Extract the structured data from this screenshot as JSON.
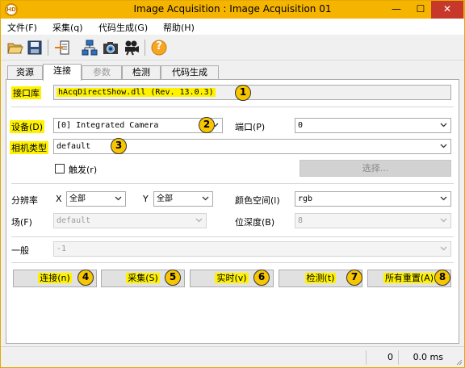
{
  "window": {
    "title": "Image Acquisition : Image Acquisition 01",
    "controls": {
      "minimize": "—",
      "maximize": "☐",
      "close": "✕"
    }
  },
  "menu": [
    "文件(F)",
    "采集(q)",
    "代码生成(G)",
    "帮助(H)"
  ],
  "toolbar": {
    "icons": [
      "open-folder-icon",
      "save-icon",
      "export-icon",
      "network-icon",
      "camera-icon",
      "video-camera-icon",
      "help-icon"
    ],
    "help_glyph": "?"
  },
  "tabs": [
    {
      "label": "资源",
      "state": "normal"
    },
    {
      "label": "连接",
      "state": "active"
    },
    {
      "label": "参数",
      "state": "disabled"
    },
    {
      "label": "检测",
      "state": "normal"
    },
    {
      "label": "代码生成",
      "state": "normal"
    }
  ],
  "connection": {
    "interface_label": "接口库",
    "interface_value": "hAcqDirectShow.dll (Rev. 13.0.3)",
    "device_label": "设备(D)",
    "device_value": "[0] Integrated Camera",
    "port_label": "端口(P)",
    "port_value": "0",
    "camera_type_label": "相机类型",
    "camera_type_value": "default",
    "trigger_label": "触发(r)",
    "trigger_checked": false,
    "select_button": "选择...",
    "resolution_label": "分辨率",
    "res_x_label": "X",
    "res_x_value": "全部",
    "res_y_label": "Y",
    "res_y_value": "全部",
    "color_space_label": "颜色空间(l)",
    "color_space_value": "rgb",
    "field_label": "场(F)",
    "field_value": "default",
    "bit_depth_label": "位深度(B)",
    "bit_depth_value": "8",
    "general_label": "一般",
    "general_value": "-1"
  },
  "actions": [
    {
      "label": "连接(n)",
      "marker": "4"
    },
    {
      "label": "采集(S)",
      "marker": "5"
    },
    {
      "label": "实时(v)",
      "marker": "6"
    },
    {
      "label": "检测(t)",
      "marker": "7"
    },
    {
      "label": "所有重置(A)",
      "marker": "8"
    }
  ],
  "markers": [
    "1",
    "2",
    "3"
  ],
  "status": {
    "count": "0",
    "time": "0.0 ms"
  },
  "colors": {
    "titlebar": "#f5b400",
    "highlight": "#fff200",
    "marker": "#f7c600",
    "close": "#c7382a"
  }
}
